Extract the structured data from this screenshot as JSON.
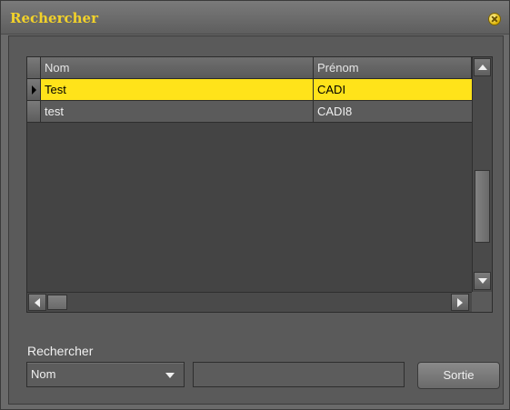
{
  "window": {
    "title": "Rechercher"
  },
  "grid": {
    "columns": [
      "Nom",
      "Prénom"
    ],
    "rows": [
      {
        "nom": "Test",
        "prenom": "CADI",
        "selected": true
      },
      {
        "nom": "test",
        "prenom": "CADI8",
        "selected": false
      }
    ]
  },
  "search": {
    "label": "Rechercher",
    "field_selected": "Nom",
    "value": "",
    "exit_label": "Sortie"
  },
  "colors": {
    "title": "#f2d22a",
    "selection": "#ffe31a",
    "background": "#5a5a5a"
  }
}
